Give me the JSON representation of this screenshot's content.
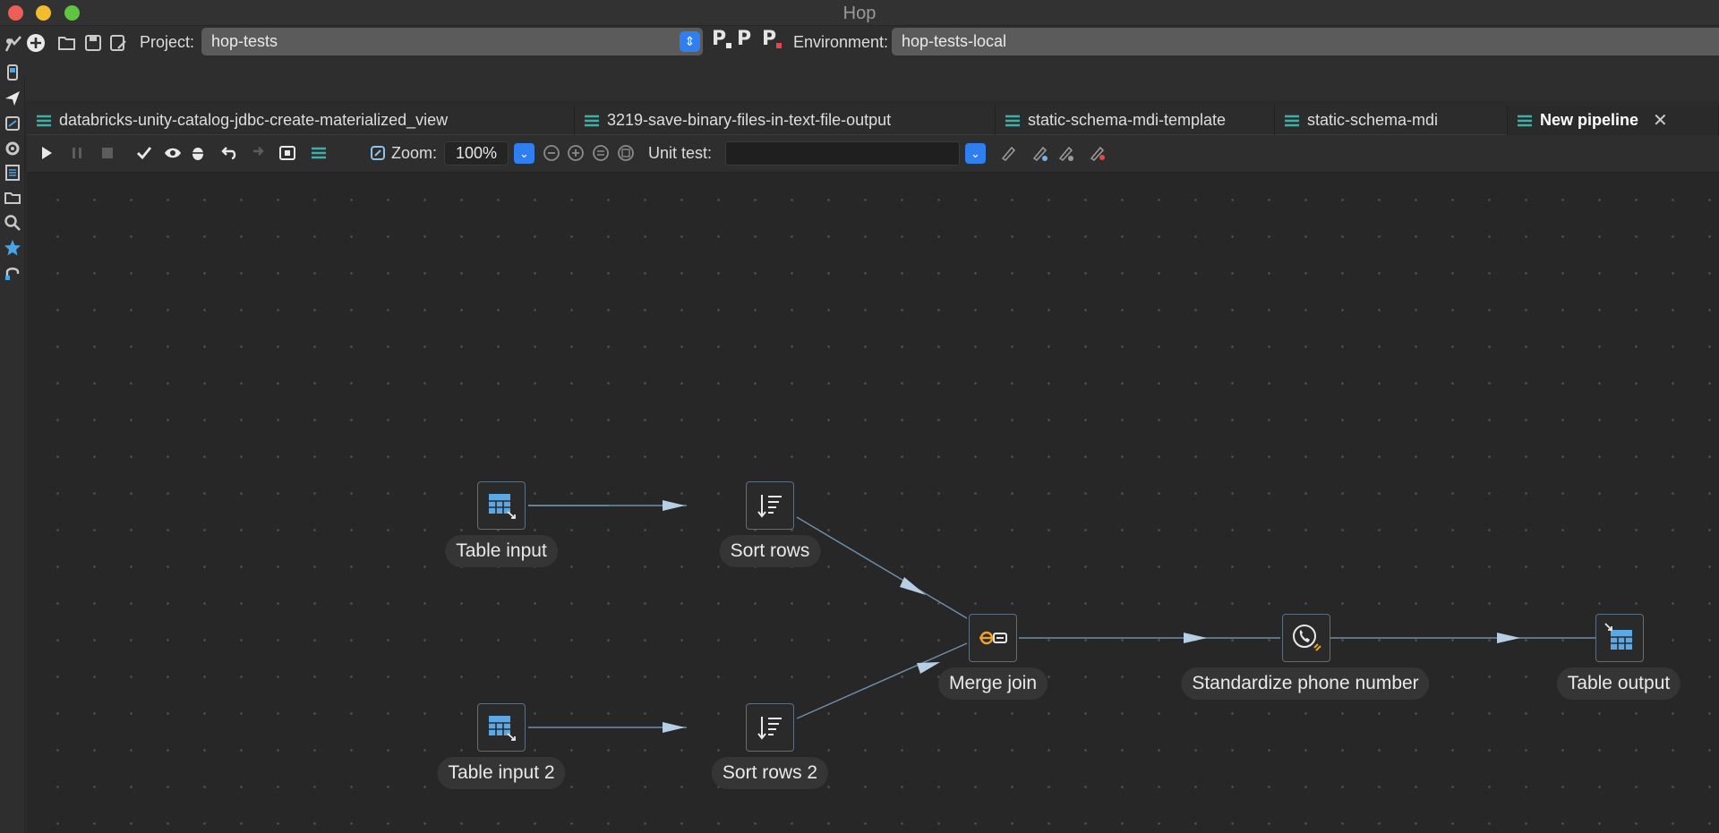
{
  "window": {
    "title": "Hop"
  },
  "toolbar": {
    "project_label": "Project:",
    "project_value": "hop-tests",
    "environment_label": "Environment:",
    "environment_value": "hop-tests-local"
  },
  "tabs": [
    {
      "label": "databricks-unity-catalog-jdbc-create-materialized_view",
      "active": false
    },
    {
      "label": "3219-save-binary-files-in-text-file-output",
      "active": false
    },
    {
      "label": "static-schema-mdi-template",
      "active": false
    },
    {
      "label": "static-schema-mdi",
      "active": false
    },
    {
      "label": "New pipeline",
      "active": true
    }
  ],
  "pipeline_toolbar": {
    "zoom_label": "Zoom:",
    "zoom_value": "100%",
    "unit_test_label": "Unit test:",
    "unit_test_value": ""
  },
  "transforms": [
    {
      "id": "table-input",
      "label": "Table input",
      "icon": "table-input-icon"
    },
    {
      "id": "sort-rows",
      "label": "Sort rows",
      "icon": "sort-rows-icon"
    },
    {
      "id": "table-input-2",
      "label": "Table input 2",
      "icon": "table-input-icon"
    },
    {
      "id": "sort-rows-2",
      "label": "Sort rows 2",
      "icon": "sort-rows-icon"
    },
    {
      "id": "merge-join",
      "label": "Merge join",
      "icon": "merge-join-icon"
    },
    {
      "id": "standardize-phone",
      "label": "Standardize phone number",
      "icon": "phone-icon"
    },
    {
      "id": "table-output",
      "label": "Table output",
      "icon": "table-output-icon"
    }
  ],
  "hops": [
    [
      "table-input",
      "sort-rows"
    ],
    [
      "table-input-2",
      "sort-rows-2"
    ],
    [
      "sort-rows",
      "merge-join"
    ],
    [
      "sort-rows-2",
      "merge-join"
    ],
    [
      "merge-join",
      "standardize-phone"
    ],
    [
      "standardize-phone",
      "table-output"
    ]
  ],
  "colors": {
    "accent_blue": "#2f7ff0",
    "hop_line": "#6e8ea8",
    "hop_arrow": "#b7cfe4",
    "transform_icon_blue": "#5aa9e6",
    "merge_icon_orange": "#f0a030"
  }
}
